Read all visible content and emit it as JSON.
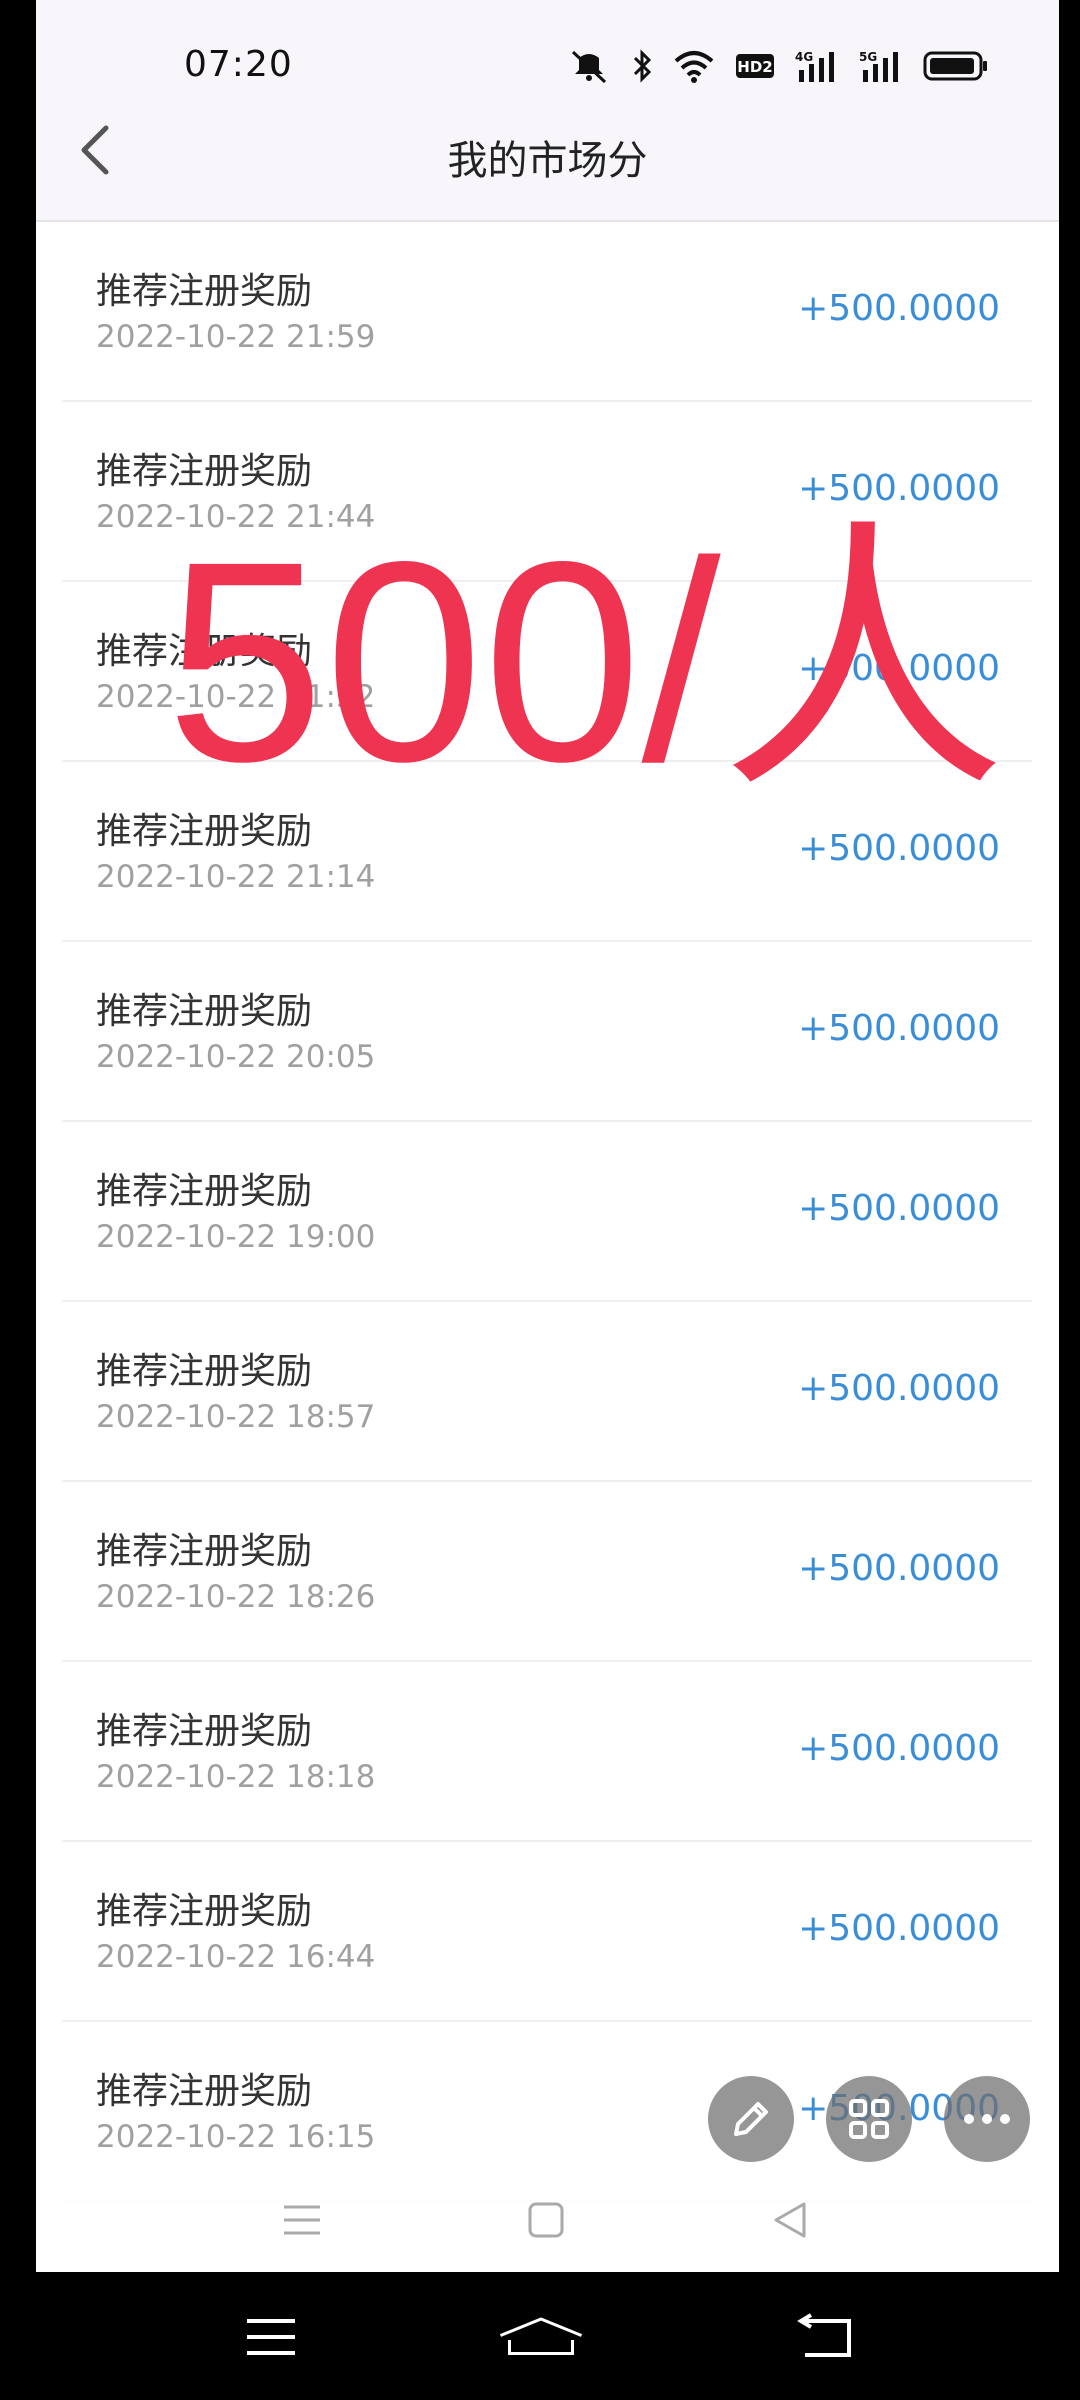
{
  "status_bar": {
    "time": "07:20",
    "network_1": "4G",
    "network_2": "5G",
    "hd_badge": "HD2"
  },
  "header": {
    "title": "我的市场分"
  },
  "records": [
    {
      "title": "推荐注册奖励",
      "time": "2022-10-22 21:59",
      "amount": "+500.0000"
    },
    {
      "title": "推荐注册奖励",
      "time": "2022-10-22 21:44",
      "amount": "+500.0000"
    },
    {
      "title": "推荐注册奖励",
      "time": "2022-10-22 21:32",
      "amount": "+500.0000"
    },
    {
      "title": "推荐注册奖励",
      "time": "2022-10-22 21:14",
      "amount": "+500.0000"
    },
    {
      "title": "推荐注册奖励",
      "time": "2022-10-22 20:05",
      "amount": "+500.0000"
    },
    {
      "title": "推荐注册奖励",
      "time": "2022-10-22 19:00",
      "amount": "+500.0000"
    },
    {
      "title": "推荐注册奖励",
      "time": "2022-10-22 18:57",
      "amount": "+500.0000"
    },
    {
      "title": "推荐注册奖励",
      "time": "2022-10-22 18:26",
      "amount": "+500.0000"
    },
    {
      "title": "推荐注册奖励",
      "time": "2022-10-22 18:18",
      "amount": "+500.0000"
    },
    {
      "title": "推荐注册奖励",
      "time": "2022-10-22 16:44",
      "amount": "+500.0000"
    },
    {
      "title": "推荐注册奖励",
      "time": "2022-10-22 16:15",
      "amount": "+500.0000"
    }
  ],
  "overlay": {
    "text": "500/人",
    "color": "#ef3452"
  },
  "colors": {
    "amount": "#3a8ed8",
    "header_bg": "#f8f6fa"
  },
  "floating_buttons": [
    "edit-icon",
    "grid-icon",
    "more-icon"
  ]
}
